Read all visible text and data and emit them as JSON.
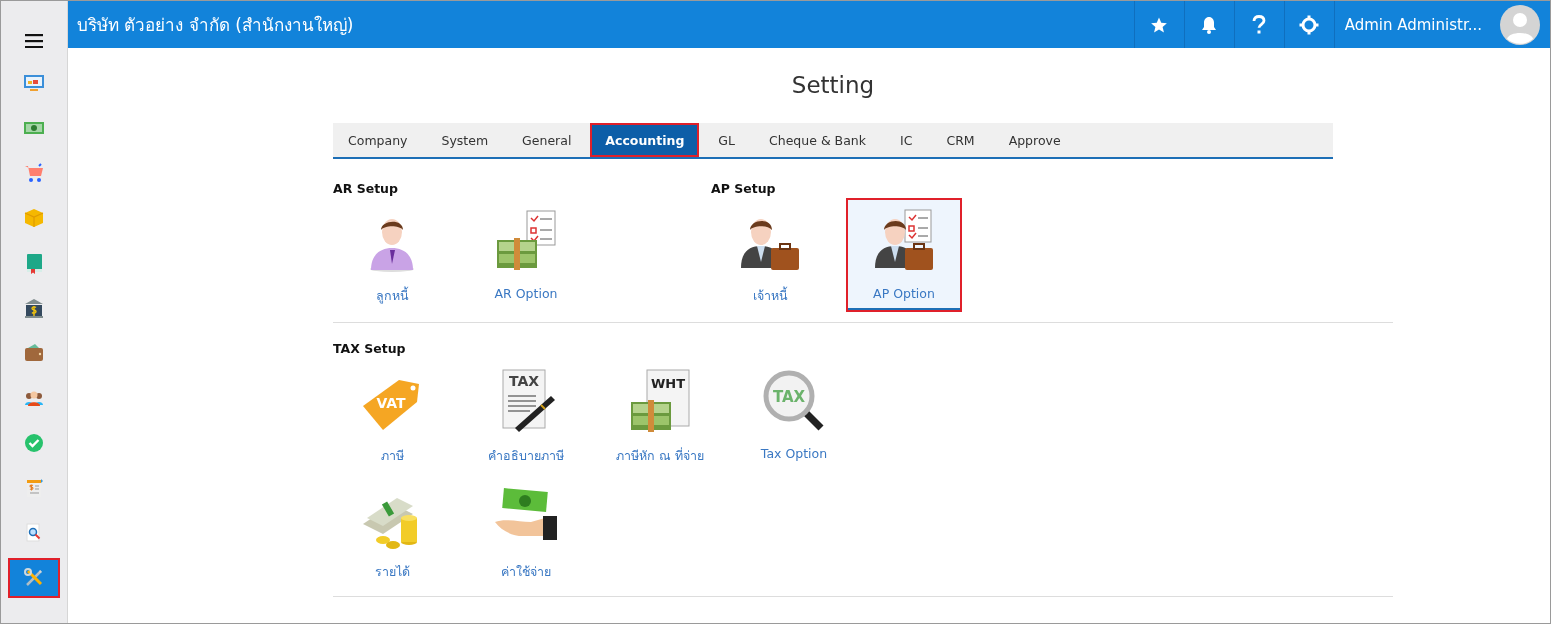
{
  "header": {
    "company": "บริษัท ตัวอย่าง จำกัด (สำนักงานใหญ่)",
    "user": "Admin Administr...",
    "actions": [
      {
        "kind": "star"
      },
      {
        "kind": "bell"
      },
      {
        "kind": "help"
      },
      {
        "kind": "settings"
      }
    ]
  },
  "sidebar": {
    "items": [
      {
        "kind": "monitor",
        "selected": false,
        "highlighted": false
      },
      {
        "kind": "banknote",
        "selected": false,
        "highlighted": false
      },
      {
        "kind": "cart",
        "selected": false,
        "highlighted": false
      },
      {
        "kind": "box",
        "selected": false,
        "highlighted": false
      },
      {
        "kind": "book",
        "selected": false,
        "highlighted": false
      },
      {
        "kind": "bank",
        "selected": false,
        "highlighted": false
      },
      {
        "kind": "wallet",
        "selected": false,
        "highlighted": false
      },
      {
        "kind": "people",
        "selected": false,
        "highlighted": false
      },
      {
        "kind": "check",
        "selected": false,
        "highlighted": false
      },
      {
        "kind": "invoice",
        "selected": false,
        "highlighted": false
      },
      {
        "kind": "search-doc",
        "selected": false,
        "highlighted": false
      },
      {
        "kind": "tools",
        "selected": true,
        "highlighted": true
      }
    ]
  },
  "page_title": "Setting",
  "tabs": [
    {
      "label": "Company",
      "selected": false,
      "highlighted": false
    },
    {
      "label": "System",
      "selected": false,
      "highlighted": false
    },
    {
      "label": "General",
      "selected": false,
      "highlighted": false
    },
    {
      "label": "Accounting",
      "selected": true,
      "highlighted": true
    },
    {
      "label": "GL",
      "selected": false,
      "highlighted": false
    },
    {
      "label": "Cheque & Bank",
      "selected": false,
      "highlighted": false
    },
    {
      "label": "IC",
      "selected": false,
      "highlighted": false
    },
    {
      "label": "CRM",
      "selected": false,
      "highlighted": false
    },
    {
      "label": "Approve",
      "selected": false,
      "highlighted": false
    }
  ],
  "sections": [
    {
      "groups": [
        {
          "title": "AR Setup",
          "items": [
            {
              "label": "ลูกหนี้",
              "kind": "person",
              "selected": false,
              "highlighted": false
            },
            {
              "label": "AR Option",
              "kind": "money-checklist",
              "selected": false,
              "highlighted": false
            }
          ]
        },
        {
          "title": "AP Setup",
          "items": [
            {
              "label": "เจ้าหนี้",
              "kind": "businessman",
              "selected": false,
              "highlighted": false
            },
            {
              "label": "AP Option",
              "kind": "businessman-checklist",
              "selected": true,
              "highlighted": true
            }
          ]
        }
      ]
    },
    {
      "groups": [
        {
          "title": "TAX Setup",
          "items": [
            {
              "label": "ภาษี",
              "kind": "tag",
              "icon_text": "VAT",
              "selected": false,
              "highlighted": false
            },
            {
              "label": "คำอธิบายภาษี",
              "kind": "document-pen",
              "icon_text": "TAX",
              "selected": false,
              "highlighted": false
            },
            {
              "label": "ภาษีหัก ณ ที่จ่าย",
              "kind": "document-money",
              "icon_text": "WHT",
              "selected": false,
              "highlighted": false
            },
            {
              "label": "Tax Option",
              "kind": "magnifier",
              "icon_text": "TAX",
              "selected": false,
              "highlighted": false
            },
            {
              "label": "รายได้",
              "kind": "cash-coins",
              "selected": false,
              "highlighted": false
            },
            {
              "label": "ค่าใช้จ่าย",
              "kind": "hand-money",
              "selected": false,
              "highlighted": false
            }
          ]
        }
      ]
    }
  ]
}
